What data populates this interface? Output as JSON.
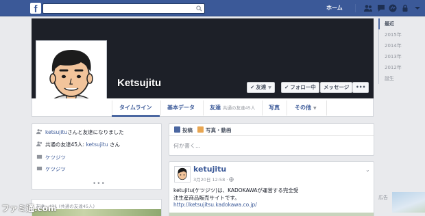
{
  "topbar": {
    "logo_letter": "f",
    "search_placeholder": "",
    "home_label": "ホーム",
    "icons": [
      "friend-requests-icon",
      "messages-icon",
      "notifications-icon",
      "privacy-icon",
      "settings-icon"
    ]
  },
  "profile": {
    "name": "Ketsujitu",
    "buttons": {
      "friends": "友達",
      "following": "フォロー中",
      "message": "メッセージ",
      "more": "•••"
    }
  },
  "tabs": {
    "timeline": "タイムライン",
    "about": "基本データ",
    "friends": "友達",
    "friends_sub": "共通の友達45人",
    "photos": "写真",
    "more": "その他"
  },
  "years": [
    "最近",
    "2015年",
    "2014年",
    "2013年",
    "2012年",
    "誕生"
  ],
  "activity": {
    "friend_name": "ketsujitu",
    "friend_text": "さんと友達になりました",
    "mutual_prefix": "共通の友達45人: ",
    "mutual_name": "ketsujitu",
    "mutual_suffix": " さん",
    "item_1": "ケツジツ",
    "item_2": "ケツジツ",
    "more": "•••"
  },
  "photos_strip": {
    "label": "友達 · 421 (共通の友達45人)"
  },
  "composer": {
    "post_tab": "投稿",
    "photo_tab": "写真・動画",
    "placeholder": "何か書く..."
  },
  "post": {
    "author": "ketujitu",
    "date": "3月20日 12:58 · ",
    "text_line1": "ketujitu(ケツジツ)は、KADOKAWAが運営する完全受",
    "text_line2": "注生産商品販売サイトです。",
    "link": "http://ketsujitsu.kadokawa.co.jp/"
  },
  "sidebar": {
    "ad_label": "広告"
  },
  "watermark": "ファミ通.com",
  "colors": {
    "brand": "#3b5998",
    "cover": "#1d2028",
    "page_bg": "#e9eaed",
    "link": "#3b5998"
  }
}
